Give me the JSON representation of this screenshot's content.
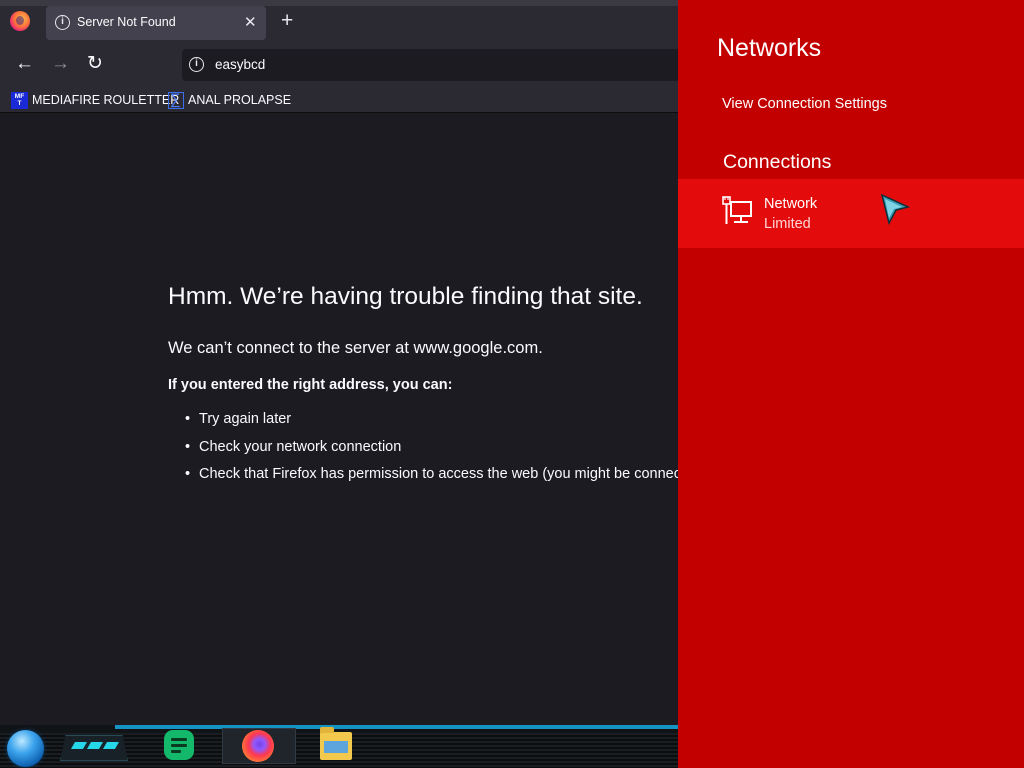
{
  "browser": {
    "tab": {
      "title": "Server Not Found",
      "close_glyph": "✕",
      "icon": "info-icon"
    },
    "new_tab_glyph": "+",
    "nav": {
      "back_glyph": "←",
      "forward_glyph": "→",
      "reload_glyph": "↻"
    },
    "urlbar": {
      "value": "easybcd",
      "icon": "info-icon"
    },
    "bookmarks": [
      {
        "label": "MEDIAFIRE ROULETTER",
        "icon_text": "MF T"
      },
      {
        "label": "ANAL PROLAPSE"
      }
    ]
  },
  "error_page": {
    "title": "Hmm. We’re having trouble finding that site.",
    "description": "We can’t connect to the server at www.google.com.",
    "subheading": "If you entered the right address, you can:",
    "suggestions": [
      "Try again later",
      "Check your network connection",
      "Check that Firefox has permission to access the web (you might be connected but behind a firewall)"
    ]
  },
  "networks_flyout": {
    "title": "Networks",
    "settings_link": "View Connection Settings",
    "connections_heading": "Connections",
    "network": {
      "name": "Network",
      "status": "Limited",
      "icon": "ethernet-icon"
    },
    "colors": {
      "background": "#c30000",
      "selected_item": "#e30b0b"
    }
  },
  "taskbar": {
    "items": [
      "start-orb",
      "notes-app",
      "firefox",
      "file-explorer"
    ]
  }
}
